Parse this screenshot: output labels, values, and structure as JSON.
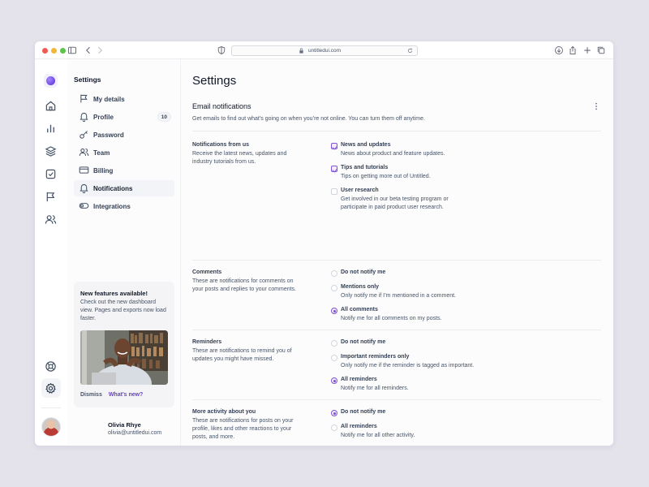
{
  "browser": {
    "url": "untitledui.com"
  },
  "subnav": {
    "title": "Settings",
    "items": [
      {
        "label": "My details",
        "icon": "flag-icon"
      },
      {
        "label": "Profile",
        "icon": "bell-icon",
        "badge": "10"
      },
      {
        "label": "Password",
        "icon": "key-icon"
      },
      {
        "label": "Team",
        "icon": "users-icon"
      },
      {
        "label": "Billing",
        "icon": "credit-card-icon"
      },
      {
        "label": "Notifications",
        "icon": "bell-icon",
        "active": true
      },
      {
        "label": "Integrations",
        "icon": "toggle-icon"
      }
    ]
  },
  "feature_card": {
    "title": "New features available!",
    "body": "Check out the new dashboard view. Pages and exports now load faster.",
    "dismiss": "Dismiss",
    "whats_new": "What’s new?"
  },
  "user": {
    "name": "Olivia Rhye",
    "email": "olivia@untitledui.com"
  },
  "main": {
    "title": "Settings",
    "section_title": "Email notifications",
    "section_desc": "Get emails to find out what’s going on when you’re not online. You can turn them off anytime.",
    "groups": [
      {
        "title": "Notifications from us",
        "desc": "Receive the latest news, updates and industry tutorials from us.",
        "options": [
          {
            "type": "checkbox",
            "checked": true,
            "label": "News and updates",
            "desc": "News about product and feature updates."
          },
          {
            "type": "checkbox",
            "checked": true,
            "label": "Tips and tutorials",
            "desc": "Tips on getting more out of Untitled."
          },
          {
            "type": "checkbox",
            "checked": false,
            "label": "User research",
            "desc": "Get involved in our beta testing program or participate in paid product user research."
          }
        ]
      },
      {
        "title": "Comments",
        "desc": "These are notifications for comments on your posts and replies to your comments.",
        "options": [
          {
            "type": "radio",
            "checked": false,
            "label": "Do not notify me",
            "desc": ""
          },
          {
            "type": "radio",
            "checked": false,
            "label": "Mentions only",
            "desc": "Only notify me if I’m mentioned in a comment."
          },
          {
            "type": "radio",
            "checked": true,
            "label": "All comments",
            "desc": "Notify me for all comments on my posts."
          }
        ]
      },
      {
        "title": "Reminders",
        "desc": "These are notifications to remind you of updates you might have missed.",
        "options": [
          {
            "type": "radio",
            "checked": false,
            "label": "Do not notify me",
            "desc": ""
          },
          {
            "type": "radio",
            "checked": false,
            "label": "Important reminders only",
            "desc": "Only notify me if the reminder is tagged as important."
          },
          {
            "type": "radio",
            "checked": true,
            "label": "All reminders",
            "desc": "Notify me for all reminders."
          }
        ]
      },
      {
        "title": "More activity about you",
        "desc": "These are notifications for posts on your profile, likes and other reactions to your posts, and more.",
        "options": [
          {
            "type": "radio",
            "checked": true,
            "label": "Do not notify me",
            "desc": ""
          },
          {
            "type": "radio",
            "checked": false,
            "label": "All reminders",
            "desc": "Notify me for all other activity."
          }
        ]
      }
    ]
  },
  "colors": {
    "accent": "#7f56d9",
    "page_bg": "#e4e3ec"
  }
}
